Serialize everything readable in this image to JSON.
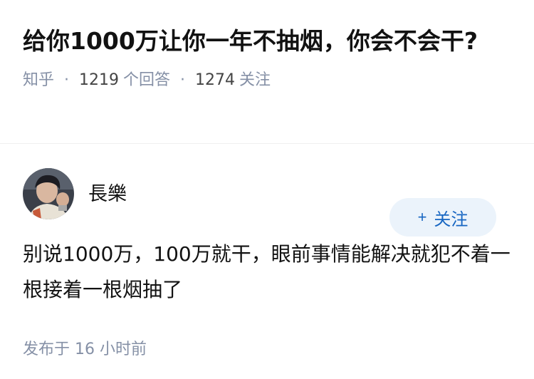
{
  "question": {
    "title": "给你1000万让你一年不抽烟，你会不会干?",
    "source": "知乎",
    "answer_count": "1219",
    "answer_label": "个回答",
    "follow_count": "1274",
    "follow_label": "关注"
  },
  "answer": {
    "author_name": "長樂",
    "follow_button": {
      "icon": "+",
      "label": "关注"
    },
    "content": "别说1000万，100万就干，眼前事情能解决就犯不着一根接着一根烟抽了",
    "published": "发布于 16 小时前"
  },
  "colors": {
    "accent": "#1766c2",
    "accent_bg": "#ebf3fb",
    "meta_gray": "#8590a6"
  }
}
